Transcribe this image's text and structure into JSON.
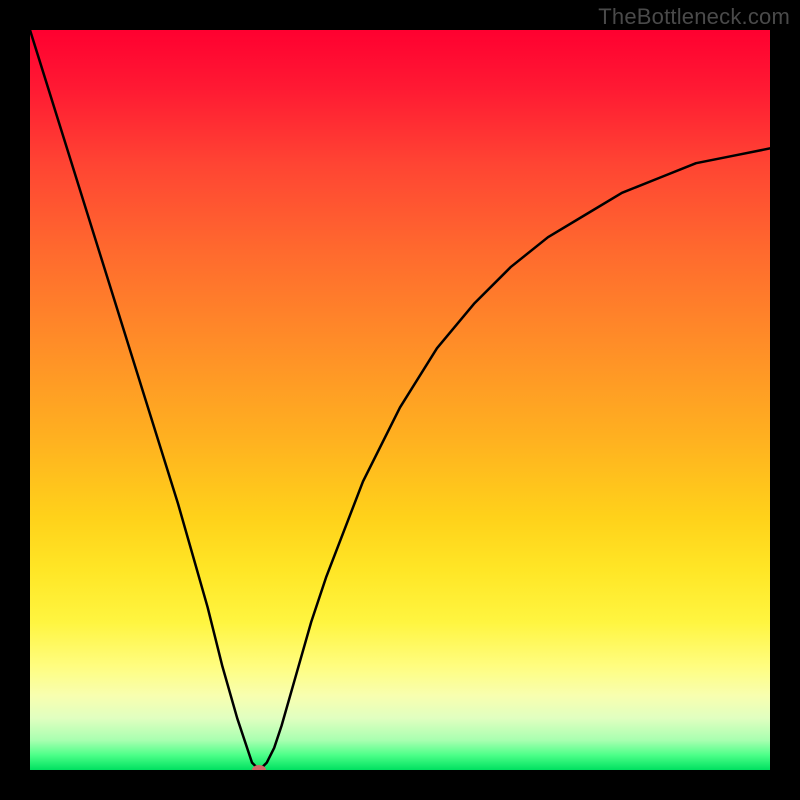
{
  "watermark": {
    "text": "TheBottleneck.com"
  },
  "chart_data": {
    "type": "line",
    "title": "",
    "xlabel": "",
    "ylabel": "",
    "xlim": [
      0,
      100
    ],
    "ylim": [
      0,
      100
    ],
    "grid": false,
    "legend": false,
    "background_gradient": {
      "stops": [
        {
          "offset": 0,
          "color": "#ff0030"
        },
        {
          "offset": 50,
          "color": "#ffb020"
        },
        {
          "offset": 80,
          "color": "#fff540"
        },
        {
          "offset": 100,
          "color": "#00e060"
        }
      ]
    },
    "series": [
      {
        "name": "bottleneck-curve",
        "x": [
          0,
          5,
          10,
          15,
          20,
          22,
          24,
          26,
          28,
          30,
          31,
          32,
          33,
          34,
          36,
          38,
          40,
          45,
          50,
          55,
          60,
          65,
          70,
          75,
          80,
          85,
          90,
          95,
          100
        ],
        "values": [
          100,
          84,
          68,
          52,
          36,
          29,
          22,
          14,
          7,
          1,
          0,
          1,
          3,
          6,
          13,
          20,
          26,
          39,
          49,
          57,
          63,
          68,
          72,
          75,
          78,
          80,
          82,
          83,
          84
        ]
      }
    ],
    "minimum_point": {
      "x": 31,
      "y": 0
    }
  }
}
